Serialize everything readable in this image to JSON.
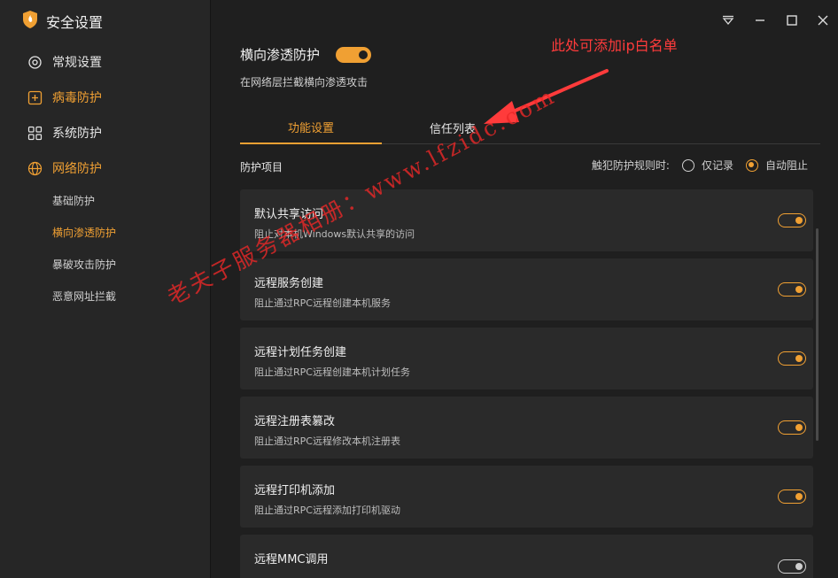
{
  "app": {
    "title": "安全设置"
  },
  "sidebar": {
    "items": [
      {
        "label": "常规设置",
        "icon": "gear-icon"
      },
      {
        "label": "病毒防护",
        "icon": "plus-square-icon"
      },
      {
        "label": "系统防护",
        "icon": "grid-icon"
      },
      {
        "label": "网络防护",
        "icon": "globe-icon"
      }
    ],
    "sub_items": [
      {
        "label": "基础防护"
      },
      {
        "label": "横向渗透防护"
      },
      {
        "label": "暴破攻击防护"
      },
      {
        "label": "恶意网址拦截"
      }
    ]
  },
  "window_controls": [
    "dropdown-menu-icon",
    "minimize-icon",
    "maximize-icon",
    "close-icon"
  ],
  "feature": {
    "title": "横向渗透防护",
    "enabled": true,
    "description": "在网络层拦截横向渗透攻击"
  },
  "tabs": [
    {
      "label": "功能设置",
      "active": true
    },
    {
      "label": "信任列表",
      "active": false
    }
  ],
  "section": {
    "title": "防护项目",
    "rule_label": "触犯防护规则时:",
    "options": [
      {
        "label": "仅记录",
        "checked": false
      },
      {
        "label": "自动阻止",
        "checked": true
      }
    ]
  },
  "items": [
    {
      "title": "默认共享访问",
      "desc": "阻止对本机Windows默认共享的访问",
      "enabled": true
    },
    {
      "title": "远程服务创建",
      "desc": "阻止通过RPC远程创建本机服务",
      "enabled": true
    },
    {
      "title": "远程计划任务创建",
      "desc": "阻止通过RPC远程创建本机计划任务",
      "enabled": true
    },
    {
      "title": "远程注册表篡改",
      "desc": "阻止通过RPC远程修改本机注册表",
      "enabled": true
    },
    {
      "title": "远程打印机添加",
      "desc": "阻止通过RPC远程添加打印机驱动",
      "enabled": true
    },
    {
      "title": "远程MMC调用",
      "desc": "",
      "enabled": false
    }
  ],
  "annotation": {
    "text": "此处可添加ip白名单"
  },
  "watermark": {
    "text": "老夫子服务器相册：www.lfzidc.com"
  },
  "colors": {
    "accent": "#f0a033",
    "annotation": "#ff3b3b",
    "background": "#1f1f1f",
    "sidebar": "#262626",
    "card": "#2a2a2a"
  }
}
